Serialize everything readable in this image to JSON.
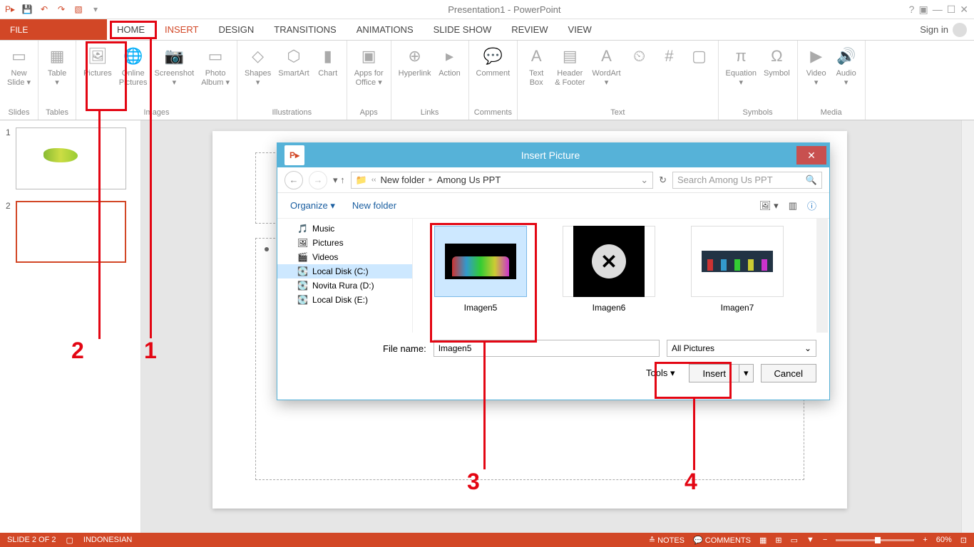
{
  "app": {
    "title": "Presentation1 - PowerPoint",
    "signin": "Sign in"
  },
  "qat": [
    "save",
    "undo",
    "redo",
    "start"
  ],
  "tabs": {
    "file": "FILE",
    "items": [
      "HOME",
      "INSERT",
      "DESIGN",
      "TRANSITIONS",
      "ANIMATIONS",
      "SLIDE SHOW",
      "REVIEW",
      "VIEW"
    ],
    "active": 1
  },
  "ribbon": {
    "groups": [
      {
        "label": "Slides",
        "items": [
          {
            "name": "new-slide",
            "label": "New\nSlide ▾"
          }
        ]
      },
      {
        "label": "Tables",
        "items": [
          {
            "name": "table",
            "label": "Table\n▾"
          }
        ]
      },
      {
        "label": "Images",
        "items": [
          {
            "name": "pictures",
            "label": "Pictures"
          },
          {
            "name": "online-pictures",
            "label": "Online\nPictures"
          },
          {
            "name": "screenshot",
            "label": "Screenshot\n▾"
          },
          {
            "name": "photo-album",
            "label": "Photo\nAlbum ▾"
          }
        ]
      },
      {
        "label": "Illustrations",
        "items": [
          {
            "name": "shapes",
            "label": "Shapes\n▾"
          },
          {
            "name": "smartart",
            "label": "SmartArt"
          },
          {
            "name": "chart",
            "label": "Chart"
          }
        ]
      },
      {
        "label": "Apps",
        "items": [
          {
            "name": "apps-office",
            "label": "Apps for\nOffice ▾"
          }
        ]
      },
      {
        "label": "Links",
        "items": [
          {
            "name": "hyperlink",
            "label": "Hyperlink"
          },
          {
            "name": "action",
            "label": "Action"
          }
        ]
      },
      {
        "label": "Comments",
        "items": [
          {
            "name": "comment",
            "label": "Comment"
          }
        ]
      },
      {
        "label": "Text",
        "items": [
          {
            "name": "text-box",
            "label": "Text\nBox"
          },
          {
            "name": "header-footer",
            "label": "Header\n& Footer"
          },
          {
            "name": "wordart",
            "label": "WordArt\n▾"
          },
          {
            "name": "date-time",
            "label": ""
          },
          {
            "name": "slide-num",
            "label": ""
          },
          {
            "name": "object",
            "label": ""
          }
        ]
      },
      {
        "label": "Symbols",
        "items": [
          {
            "name": "equation",
            "label": "Equation\n▾"
          },
          {
            "name": "symbol",
            "label": "Symbol"
          }
        ]
      },
      {
        "label": "Media",
        "items": [
          {
            "name": "video",
            "label": "Video\n▾"
          },
          {
            "name": "audio",
            "label": "Audio\n▾"
          }
        ]
      }
    ]
  },
  "slides": {
    "count": 2,
    "selected": 2
  },
  "dialog": {
    "title": "Insert Picture",
    "breadcrumb": [
      "New folder",
      "Among Us PPT"
    ],
    "search_placeholder": "Search Among Us PPT",
    "organize": "Organize ▾",
    "newfolder": "New folder",
    "tree": [
      {
        "icon": "🎵",
        "label": "Music"
      },
      {
        "icon": "🖼",
        "label": "Pictures"
      },
      {
        "icon": "🎬",
        "label": "Videos"
      },
      {
        "icon": "💽",
        "label": "Local Disk (C:)",
        "sel": true
      },
      {
        "icon": "💽",
        "label": "Novita Rura (D:)"
      },
      {
        "icon": "💽",
        "label": "Local Disk (E:)"
      }
    ],
    "files": [
      {
        "name": "Imagen5",
        "sel": true
      },
      {
        "name": "Imagen6"
      },
      {
        "name": "Imagen7"
      }
    ],
    "filename_label": "File name:",
    "filename_value": "Imagen5",
    "filter": "All Pictures",
    "tools": "Tools   ▾",
    "insert": "Insert",
    "cancel": "Cancel"
  },
  "status": {
    "slide": "SLIDE 2 OF 2",
    "lang": "INDONESIAN",
    "notes": "NOTES",
    "comments": "COMMENTS",
    "zoom": "60%"
  },
  "annotations": {
    "n1": "1",
    "n2": "2",
    "n3": "3",
    "n4": "4"
  }
}
